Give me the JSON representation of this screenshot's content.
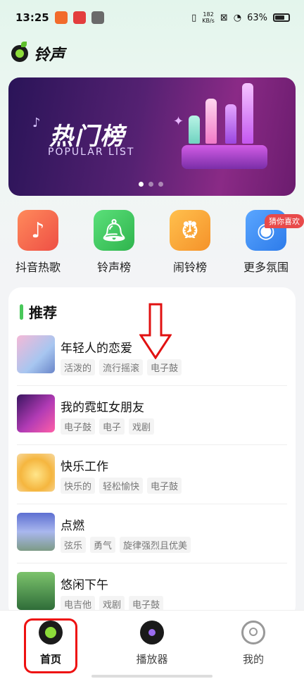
{
  "status_bar": {
    "time": "13:25",
    "net_speed_value": "182",
    "net_speed_unit": "KB/s",
    "battery": "63%"
  },
  "app": {
    "title": "铃声"
  },
  "banner": {
    "title": "热门榜",
    "subtitle": "POPULAR LIST",
    "dot_count": 3,
    "active_dot": 0
  },
  "shortcuts": [
    {
      "label": "抖音热歌",
      "icon": "tiktok-icon",
      "color": "#f06a4e"
    },
    {
      "label": "铃声榜",
      "icon": "bell-icon",
      "color": "#3cc45a"
    },
    {
      "label": "闹铃榜",
      "icon": "alarm-clock-icon",
      "color": "#f5a43a"
    },
    {
      "label": "更多氛围",
      "icon": "music-disc-icon",
      "color": "#3b8df3",
      "badge": "猜你喜欢"
    }
  ],
  "recommend": {
    "title": "推荐",
    "songs": [
      {
        "title": "年轻人的恋爱",
        "tags": [
          "活泼的",
          "流行摇滚",
          "电子鼓"
        ]
      },
      {
        "title": "我的霓虹女朋友",
        "tags": [
          "电子鼓",
          "电子",
          "戏剧"
        ]
      },
      {
        "title": "快乐工作",
        "tags": [
          "快乐的",
          "轻松愉快",
          "电子鼓"
        ]
      },
      {
        "title": "点燃",
        "tags": [
          "弦乐",
          "勇气",
          "旋律强烈且优美"
        ]
      },
      {
        "title": "悠闲下午",
        "tags": [
          "电吉他",
          "戏剧",
          "电子鼓"
        ]
      }
    ]
  },
  "tabbar": {
    "tabs": [
      {
        "label": "首页",
        "icon": "home-logo-icon",
        "active": true
      },
      {
        "label": "播放器",
        "icon": "vinyl-record-icon",
        "active": false
      },
      {
        "label": "我的",
        "icon": "profile-icon",
        "active": false
      }
    ]
  },
  "colors": {
    "accent_green": "#49c85a",
    "annotation_red": "#e11111"
  }
}
